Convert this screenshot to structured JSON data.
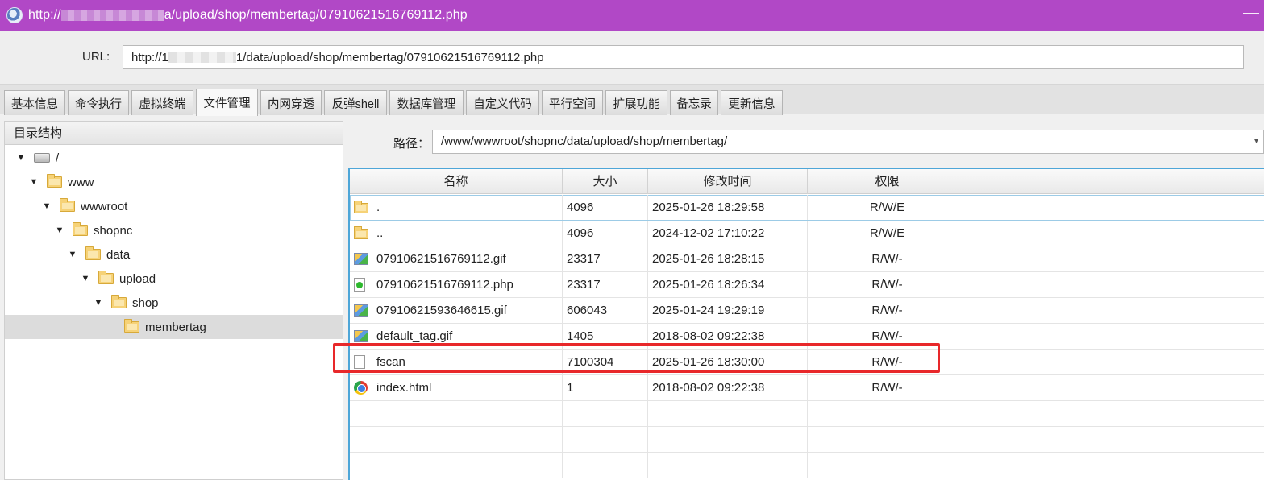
{
  "window": {
    "title": "http://████████/data/upload/shop/membertag/07910621516769112.php",
    "title_prefix": "http://",
    "title_suffix": "a/upload/shop/membertag/07910621516769112.php",
    "minimize_label": "—"
  },
  "url_bar": {
    "label": "URL:",
    "value_prefix": "http://1",
    "value_suffix": "1/data/upload/shop/membertag/07910621516769112.php"
  },
  "tabs": [
    {
      "label": "基本信息",
      "active": false
    },
    {
      "label": "命令执行",
      "active": false
    },
    {
      "label": "虚拟终端",
      "active": false
    },
    {
      "label": "文件管理",
      "active": true
    },
    {
      "label": "内网穿透",
      "active": false
    },
    {
      "label": "反弹shell",
      "active": false
    },
    {
      "label": "数据库管理",
      "active": false
    },
    {
      "label": "自定义代码",
      "active": false
    },
    {
      "label": "平行空间",
      "active": false
    },
    {
      "label": "扩展功能",
      "active": false
    },
    {
      "label": "备忘录",
      "active": false
    },
    {
      "label": "更新信息",
      "active": false
    }
  ],
  "tree": {
    "header": "目录结构",
    "nodes": [
      {
        "label": "/",
        "icon": "drive-icon",
        "expanded": true
      },
      {
        "label": "www",
        "icon": "folder-icon",
        "expanded": true
      },
      {
        "label": "wwwroot",
        "icon": "folder-icon",
        "expanded": true
      },
      {
        "label": "shopnc",
        "icon": "folder-icon",
        "expanded": true
      },
      {
        "label": "data",
        "icon": "folder-icon",
        "expanded": true
      },
      {
        "label": "upload",
        "icon": "folder-icon",
        "expanded": true
      },
      {
        "label": "shop",
        "icon": "folder-icon",
        "expanded": true
      },
      {
        "label": "membertag",
        "icon": "folder-icon",
        "expanded": false,
        "selected": true
      }
    ]
  },
  "path_bar": {
    "label": "路径：",
    "value": "/www/wwwroot/shopnc/data/upload/shop/membertag/"
  },
  "file_table": {
    "columns": [
      "名称",
      "大小",
      "修改时间",
      "权限"
    ],
    "rows": [
      {
        "name": ".",
        "size": "4096",
        "mtime": "2025-01-26 18:29:58",
        "perm": "R/W/E",
        "icon": "folder-icon"
      },
      {
        "name": "..",
        "size": "4096",
        "mtime": "2024-12-02 17:10:22",
        "perm": "R/W/E",
        "icon": "folder-icon"
      },
      {
        "name": "07910621516769112.gif",
        "size": "23317",
        "mtime": "2025-01-26 18:28:15",
        "perm": "R/W/-",
        "icon": "image-file-icon"
      },
      {
        "name": "07910621516769112.php",
        "size": "23317",
        "mtime": "2025-01-26 18:26:34",
        "perm": "R/W/-",
        "icon": "php-file-icon"
      },
      {
        "name": "07910621593646615.gif",
        "size": "606043",
        "mtime": "2025-01-24 19:29:19",
        "perm": "R/W/-",
        "icon": "image-file-icon"
      },
      {
        "name": "default_tag.gif",
        "size": "1405",
        "mtime": "2018-08-02 09:22:38",
        "perm": "R/W/-",
        "icon": "image-file-icon"
      },
      {
        "name": "fscan",
        "size": "7100304",
        "mtime": "2025-01-26 18:30:00",
        "perm": "R/W/-",
        "icon": "blank-file-icon"
      },
      {
        "name": "index.html",
        "size": "1",
        "mtime": "2018-08-02 09:22:38",
        "perm": "R/W/-",
        "icon": "html-file-icon"
      }
    ],
    "highlighted_row": "fscan",
    "highlight_color": "#e8282a"
  },
  "colors": {
    "titlebar": "#b148c6",
    "grid_border": "#4ea6d8"
  }
}
